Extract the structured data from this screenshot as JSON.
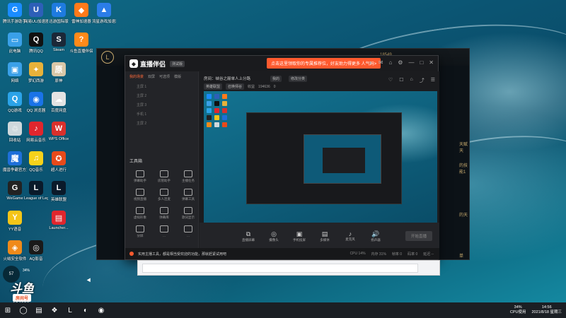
{
  "desktop": {
    "icons": [
      {
        "label": "腾讯手游助手(腾讯...",
        "name": "tencent-mobile-game-icon",
        "color": "#1a8cff",
        "glyph": "G"
      },
      {
        "label": "网易UU加速器",
        "name": "uu-accelerator-icon",
        "color": "#2d5fb8",
        "glyph": "U"
      },
      {
        "label": "迅游国际版",
        "name": "xunyou-icon",
        "color": "#1e7be0",
        "glyph": "K"
      },
      {
        "label": "雷神加速器",
        "name": "leishen-icon",
        "color": "#ff7a1a",
        "glyph": "◆"
      },
      {
        "label": "流星游戏加速器",
        "name": "liuxing-icon",
        "color": "#2b7de9",
        "glyph": "▲"
      },
      {
        "label": "此电脑",
        "name": "this-pc-icon",
        "color": "#3aa0e8",
        "glyph": "▭"
      },
      {
        "label": "腾讯QQ",
        "name": "tencent-qq-icon",
        "color": "#111",
        "glyph": "Q"
      },
      {
        "label": "Steam",
        "name": "steam-icon",
        "color": "#1b2838",
        "glyph": "S"
      },
      {
        "label": "斗鱼直播伴侣",
        "name": "douyu-companion-icon",
        "color": "#ff8a1a",
        "glyph": "?"
      },
      {
        "label": "网络",
        "name": "network-icon",
        "color": "#3aa0e8",
        "glyph": "▣"
      },
      {
        "label": "梦幻西游",
        "name": "menghuan-icon",
        "color": "#e8b23a",
        "glyph": "✦"
      },
      {
        "label": "原神",
        "name": "genshin-icon",
        "color": "#d9c7a8",
        "glyph": "原"
      },
      {
        "label": "QQ游戏",
        "name": "qq-game-icon",
        "color": "#2ba3e8",
        "glyph": "Q"
      },
      {
        "label": "QQ 浏览器",
        "name": "qq-browser-icon",
        "color": "#1a73e8",
        "glyph": "◉"
      },
      {
        "label": "百度网盘",
        "name": "baidu-netdisk-icon",
        "color": "#e3e3e3",
        "glyph": "☁"
      },
      {
        "label": "回收站",
        "name": "recycle-bin-icon",
        "color": "#cfd8dc",
        "glyph": "♲"
      },
      {
        "label": "网易云音乐",
        "name": "netease-music-icon",
        "color": "#e0262d",
        "glyph": "♪"
      },
      {
        "label": "WPS Office",
        "name": "wps-icon",
        "color": "#d9302c",
        "glyph": "W"
      },
      {
        "label": "魔兽争霸官方对战平台",
        "name": "warcraft-platform-icon",
        "color": "#1e6fd9",
        "glyph": "魔"
      },
      {
        "label": "QQ音乐",
        "name": "qq-music-icon",
        "color": "#f6d21a",
        "glyph": "♫"
      },
      {
        "label": "超人进行",
        "name": "superman-icon",
        "color": "#e84a1a",
        "glyph": "✪"
      },
      {
        "label": "WeGame",
        "name": "wegame-icon",
        "color": "#222",
        "glyph": "G"
      },
      {
        "label": "League of Legends",
        "name": "league-icon",
        "color": "#0a1a2a",
        "glyph": "L"
      },
      {
        "label": "英雄联盟",
        "name": "lol-cn-icon",
        "color": "#0a1a2a",
        "glyph": "L"
      },
      {
        "label": "YY语音",
        "name": "yy-icon",
        "color": "#f5c518",
        "glyph": "Y"
      },
      {
        "label": "Launcher...",
        "name": "launcher-icon",
        "color": "#e0262d",
        "glyph": "▤"
      },
      {
        "label": "火绒安全软件",
        "name": "huorong-icon",
        "color": "#f08a1a",
        "glyph": "◈"
      },
      {
        "label": "AQ影音",
        "name": "aq-player-icon",
        "color": "#1a1a1a",
        "glyph": "◎"
      }
    ]
  },
  "lol_client": {
    "logo": "L",
    "coins": "18549",
    "side_text": [
      "天赋天",
      "的技能1",
      "的天",
      "单"
    ]
  },
  "app": {
    "brand": "直播伴侣",
    "version": "测试版",
    "promo": "点击这里领取你的专属推荐位，好友助力得更多 人气码>",
    "window_controls": [
      "◐",
      "✉",
      "⌂",
      "⚙",
      "—",
      "□",
      "✕"
    ],
    "scene_tabs": [
      "我的场景",
      "双屏",
      "可选项",
      "模版"
    ],
    "scenes": [
      "主屏 1",
      "主屏 2",
      "主屏 3",
      "手机 1",
      "主屏 2"
    ],
    "tools_title": "工具箱",
    "tools": [
      "弹幕助手",
      "房管助手",
      "主播任务",
      "视频直播",
      "多人连麦",
      "弹幕工具",
      "虚拟形象",
      "弹幕库",
      "歌词显示",
      "分屏",
      "...",
      "..."
    ],
    "room_title": "房间：峡谷之巅单人上分路",
    "room_tags": [
      "我的",
      "修改分类"
    ],
    "room_meta": [
      "英雄联盟",
      "召唤师谷",
      "收益",
      "194636",
      "0"
    ],
    "right_icons": [
      "♡",
      "☐",
      "⌂",
      "⤴",
      "☰"
    ],
    "bottom_tools": [
      {
        "glyph": "⧉",
        "label": "直播屏幕"
      },
      {
        "glyph": "◎",
        "label": "摄像头"
      },
      {
        "glyph": "▣",
        "label": "手机投屏"
      },
      {
        "glyph": "▤",
        "label": "多媒体"
      },
      {
        "glyph": "♪",
        "label": "麦克风"
      },
      {
        "glyph": "🔊",
        "label": "扬声器"
      }
    ],
    "start_live": "开始直播",
    "status_text": "实用主播工具，都是相当受欢迎的功能，那就赶紧试用吧",
    "status_stats": [
      "CPU 14%",
      "内存 31%",
      "帧率 0",
      "码率 0",
      "延迟 --"
    ]
  },
  "overlay": {
    "level": "57",
    "percent": "34%",
    "logo": "斗鱼",
    "room_label": "房间号",
    "room_number": "194636"
  },
  "taskbar": {
    "start": "⊞",
    "apps": [
      "◯",
      "▤",
      "❖",
      "L",
      "◐",
      "◉"
    ],
    "cpu_percent": "34%",
    "cpu_label": "CPU使用",
    "time": "14:56",
    "date": "2021/8/18 星期三"
  }
}
